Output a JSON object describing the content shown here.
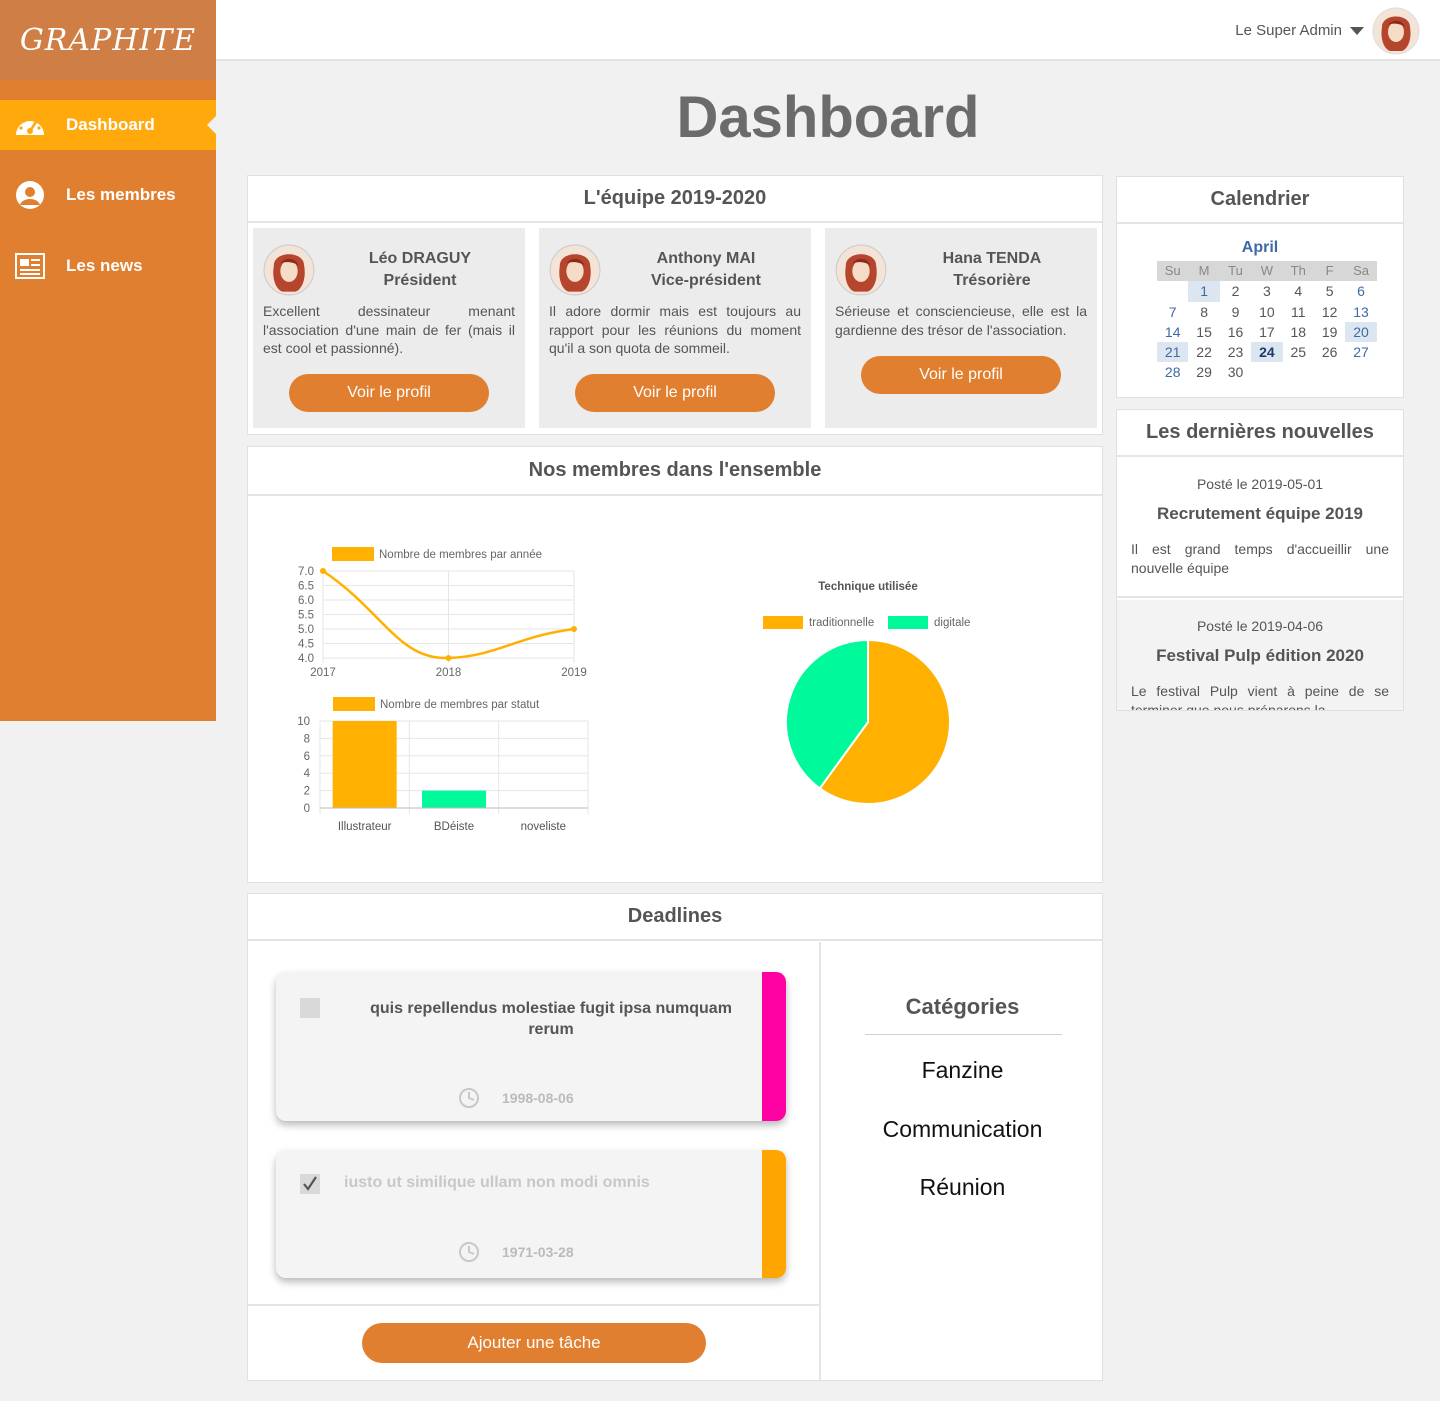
{
  "app": {
    "logo": "GRAPHITE"
  },
  "sidebar": {
    "items": [
      {
        "label": "Dashboard",
        "icon": "speedometer-icon",
        "active": true
      },
      {
        "label": "Les membres",
        "icon": "user-icon",
        "active": false
      },
      {
        "label": "Les news",
        "icon": "newspaper-icon",
        "active": false
      }
    ]
  },
  "topbar": {
    "user_name": "Le Super Admin"
  },
  "page": {
    "title": "Dashboard"
  },
  "team": {
    "title": "L'équipe 2019-2020",
    "members": [
      {
        "name": "Léo DRAGUY",
        "role": "Président",
        "description": "Excellent dessinateur menant l'association d'une main de fer (mais il est cool et passionné).",
        "button": "Voir le profil"
      },
      {
        "name": "Anthony MAI",
        "role": "Vice-président",
        "description": "Il adore dormir mais est toujours au rapport pour les réunions du moment qu'il a son quota de sommeil.",
        "button": "Voir le profil"
      },
      {
        "name": "Hana TENDA",
        "role": "Trésorière",
        "description": "Sérieuse et consciencieuse, elle est la gardienne des trésor de l'association.",
        "button": "Voir le profil"
      }
    ]
  },
  "stats": {
    "title": "Nos membres dans l'ensemble"
  },
  "chart_data": [
    {
      "type": "line",
      "legend": "Nombre de membres par année",
      "categories": [
        "2017",
        "2018",
        "2019"
      ],
      "values": [
        7,
        4,
        5
      ],
      "ylim": [
        4,
        7
      ],
      "yticks": [
        "7.0",
        "6.5",
        "6.0",
        "5.5",
        "5.0",
        "4.5",
        "4.0"
      ],
      "color": "#ffb000"
    },
    {
      "type": "bar",
      "legend": "Nombre de membres par statut",
      "categories": [
        "Illustrateur",
        "BDéiste",
        "noveliste"
      ],
      "values": [
        10,
        2,
        0
      ],
      "ylim": [
        0,
        10
      ],
      "yticks": [
        "10",
        "8",
        "6",
        "4",
        "2",
        "0"
      ],
      "colors": [
        "#ffb000",
        "#00f99a",
        "#ffb000"
      ]
    },
    {
      "type": "pie",
      "title": "Technique utilisée",
      "labels": [
        "traditionnelle",
        "digitale"
      ],
      "values": [
        60,
        40
      ],
      "colors": [
        "#ffb000",
        "#00f99a"
      ]
    }
  ],
  "calendar": {
    "title": "Calendrier",
    "month": "April",
    "weekdays": [
      "Su",
      "M",
      "Tu",
      "W",
      "Th",
      "F",
      "Sa"
    ],
    "weeks": [
      [
        "",
        "1",
        "2",
        "3",
        "4",
        "5",
        "6"
      ],
      [
        "7",
        "8",
        "9",
        "10",
        "11",
        "12",
        "13"
      ],
      [
        "14",
        "15",
        "16",
        "17",
        "18",
        "19",
        "20"
      ],
      [
        "21",
        "22",
        "23",
        "24",
        "25",
        "26",
        "27"
      ],
      [
        "28",
        "29",
        "30",
        "",
        "",
        "",
        ""
      ]
    ],
    "today": "24"
  },
  "news": {
    "title": "Les dernières nouvelles",
    "items": [
      {
        "date": "Posté le 2019-05-01",
        "title": "Recrutement équipe 2019",
        "text": "Il est grand temps d'accueillir une nouvelle équipe"
      },
      {
        "date": "Posté le 2019-04-06",
        "title": "Festival Pulp édition 2020",
        "text": "Le festival Pulp vient à peine de se terminer que nous préparons la"
      }
    ]
  },
  "deadlines": {
    "title": "Deadlines",
    "tasks": [
      {
        "title": "quis repellendus molestiae fugit ipsa numquam rerum",
        "date": "1998-08-06",
        "done": false,
        "color": "#ff00a2"
      },
      {
        "title": "iusto ut similique ullam non modi omnis",
        "date": "1971-03-28",
        "done": true,
        "color": "#ffa500"
      }
    ],
    "add_button": "Ajouter une tâche",
    "categories_title": "Catégories",
    "categories": [
      "Fanzine",
      "Communication",
      "Réunion"
    ]
  }
}
